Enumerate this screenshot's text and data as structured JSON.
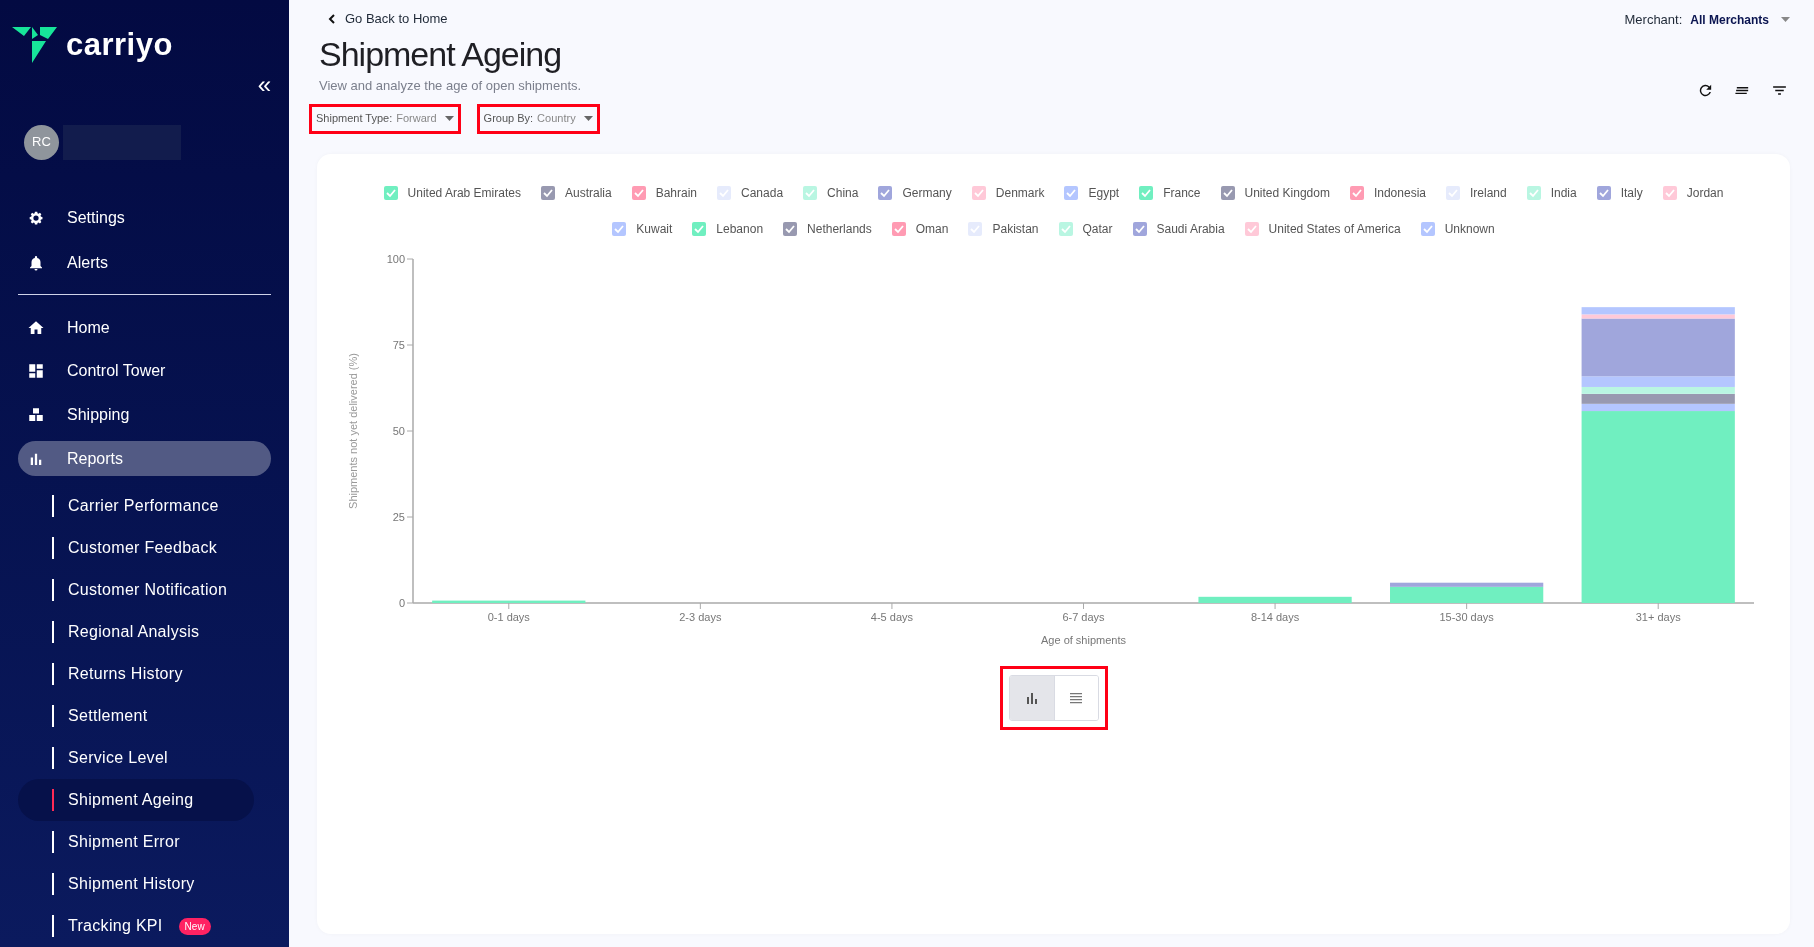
{
  "sidebar": {
    "brand": "carriyo",
    "collapse_icon": "«",
    "user": {
      "initials": "RC"
    },
    "top_items": [
      {
        "label": "Settings"
      },
      {
        "label": "Alerts"
      }
    ],
    "nav_items": [
      {
        "label": "Home",
        "selected": false
      },
      {
        "label": "Control Tower",
        "selected": false
      },
      {
        "label": "Shipping",
        "selected": false
      },
      {
        "label": "Reports",
        "selected": true
      }
    ],
    "sub_items": [
      {
        "label": "Carrier Performance",
        "selected": false
      },
      {
        "label": "Customer Feedback",
        "selected": false
      },
      {
        "label": "Customer Notification",
        "selected": false
      },
      {
        "label": "Regional Analysis",
        "selected": false
      },
      {
        "label": "Returns History",
        "selected": false
      },
      {
        "label": "Settlement",
        "selected": false
      },
      {
        "label": "Service Level",
        "selected": false
      },
      {
        "label": "Shipment Ageing",
        "selected": true
      },
      {
        "label": "Shipment Error",
        "selected": false
      },
      {
        "label": "Shipment History",
        "selected": false
      },
      {
        "label": "Tracking KPI",
        "selected": false,
        "badge": "New"
      }
    ]
  },
  "header": {
    "back_link": "Go Back to Home",
    "title": "Shipment Ageing",
    "subtitle": "View and analyze the age of open shipments.",
    "merchant_label": "Merchant:",
    "merchant_value": "All Merchants",
    "filters": [
      {
        "label": "Shipment Type:",
        "value": "Forward"
      },
      {
        "label": "Group By:",
        "value": "Country"
      }
    ]
  },
  "view_toggle": [
    {
      "kind": "chart",
      "selected": true
    },
    {
      "kind": "table",
      "selected": false
    }
  ],
  "chart_data": {
    "type": "bar",
    "stacked": true,
    "xlabel": "Age of shipments",
    "ylabel": "Shipments not yet delivered (%)",
    "ylim": [
      0,
      100
    ],
    "yticks": [
      0,
      25,
      50,
      75,
      100
    ],
    "categories": [
      "0-1 days",
      "2-3 days",
      "4-5 days",
      "6-7 days",
      "8-14 days",
      "15-30 days",
      "31+ days"
    ],
    "series": [
      {
        "name": "United Arab Emirates",
        "color": "#70efc0",
        "values": [
          0.7,
          0,
          0,
          0,
          1.8,
          4.7,
          55.8
        ]
      },
      {
        "name": "Australia",
        "color": "#9899b0",
        "values": [
          0,
          0,
          0,
          0,
          0,
          0,
          0
        ]
      },
      {
        "name": "Bahrain",
        "color": "#ff9bb3",
        "values": [
          0,
          0,
          0,
          0,
          0,
          0,
          0
        ]
      },
      {
        "name": "Canada",
        "color": "#e6ebfc",
        "values": [
          0,
          0,
          0,
          0,
          0,
          0,
          0
        ]
      },
      {
        "name": "China",
        "color": "#b9f6e2",
        "values": [
          0,
          0,
          0,
          0,
          0,
          0,
          0
        ]
      },
      {
        "name": "Germany",
        "color": "#a0a6dc",
        "values": [
          0,
          0,
          0,
          0,
          0,
          0,
          0
        ]
      },
      {
        "name": "Denmark",
        "color": "#ffc9d8",
        "values": [
          0,
          0,
          0,
          0,
          0,
          0,
          0
        ]
      },
      {
        "name": "Egypt",
        "color": "#b4c6ff",
        "values": [
          0,
          0,
          0,
          0,
          0,
          0,
          2.1
        ]
      },
      {
        "name": "France",
        "color": "#70efc0",
        "values": [
          0,
          0,
          0,
          0,
          0,
          0,
          0
        ]
      },
      {
        "name": "United Kingdom",
        "color": "#9899b0",
        "values": [
          0,
          0,
          0,
          0,
          0,
          0,
          2.9
        ]
      },
      {
        "name": "Indonesia",
        "color": "#ff9bb3",
        "values": [
          0,
          0,
          0,
          0,
          0,
          0,
          0
        ]
      },
      {
        "name": "Ireland",
        "color": "#e6ebfc",
        "values": [
          0,
          0,
          0,
          0,
          0,
          0,
          0
        ]
      },
      {
        "name": "India",
        "color": "#b9f6e2",
        "values": [
          0,
          0,
          0,
          0,
          0,
          0,
          2.0
        ]
      },
      {
        "name": "Italy",
        "color": "#a0a6dc",
        "values": [
          0,
          0,
          0,
          0,
          0,
          0,
          0
        ]
      },
      {
        "name": "Jordan",
        "color": "#ffc9d8",
        "values": [
          0,
          0,
          0,
          0,
          0,
          0,
          0
        ]
      },
      {
        "name": "Kuwait",
        "color": "#b4c6ff",
        "values": [
          0,
          0,
          0,
          0,
          0,
          0,
          3.1
        ]
      },
      {
        "name": "Lebanon",
        "color": "#70efc0",
        "values": [
          0,
          0,
          0,
          0,
          0,
          0,
          0
        ]
      },
      {
        "name": "Netherlands",
        "color": "#9899b0",
        "values": [
          0,
          0,
          0,
          0,
          0,
          0,
          0
        ]
      },
      {
        "name": "Oman",
        "color": "#ff9bb3",
        "values": [
          0,
          0,
          0,
          0,
          0,
          0,
          0
        ]
      },
      {
        "name": "Pakistan",
        "color": "#e6ebfc",
        "values": [
          0,
          0,
          0,
          0,
          0,
          0,
          0
        ]
      },
      {
        "name": "Qatar",
        "color": "#b9f6e2",
        "values": [
          0,
          0,
          0,
          0,
          0,
          0,
          0
        ]
      },
      {
        "name": "Saudi Arabia",
        "color": "#a0a6dc",
        "values": [
          0,
          0,
          0,
          0,
          0,
          1.2,
          16.8
        ]
      },
      {
        "name": "United States of America",
        "color": "#ffc9d8",
        "values": [
          0,
          0,
          0,
          0,
          0,
          0,
          1.2
        ]
      },
      {
        "name": "Unknown",
        "color": "#b4c6ff",
        "values": [
          0,
          0,
          0,
          0,
          0,
          0,
          2.1
        ]
      }
    ]
  }
}
